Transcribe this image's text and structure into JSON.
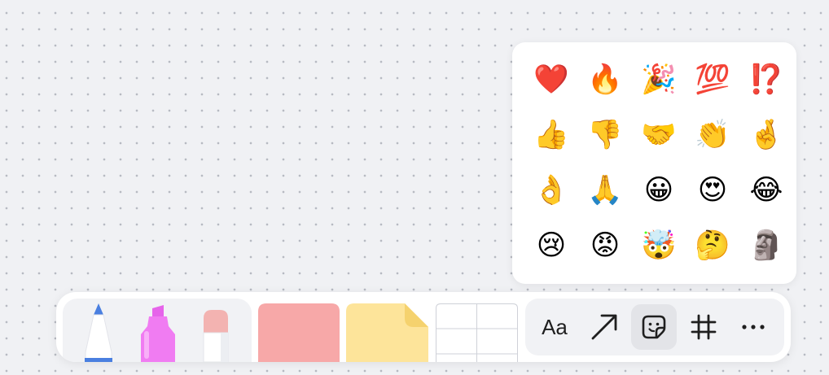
{
  "emoji_picker": {
    "emojis": [
      [
        "❤️",
        "🔥",
        "🎉",
        "💯",
        "⁉️"
      ],
      [
        "👍",
        "👎",
        "🤝",
        "👏",
        "🤞"
      ],
      [
        "👌",
        "🙏",
        "😀",
        "😍",
        "😂"
      ],
      [
        "😢",
        "😡",
        "🤯",
        "🤔",
        "🗿"
      ]
    ]
  },
  "toolbar": {
    "text_tool_label": "Aa"
  },
  "icons": {
    "pen": "pen-icon",
    "highlighter": "highlighter-icon",
    "eraser": "eraser-icon",
    "shape": "rectangle-shape-icon",
    "sticky_note": "sticky-note-icon",
    "table": "table-icon",
    "arrow": "arrow-icon",
    "sticker": "sticker-icon",
    "frame": "frame-icon",
    "more": "more-icon"
  },
  "colors": {
    "pen_tip": "#4a7fe0",
    "highlighter": "#f07cf2",
    "shape_fill": "#f7a8a8",
    "sticky_fill": "#fde49a"
  }
}
